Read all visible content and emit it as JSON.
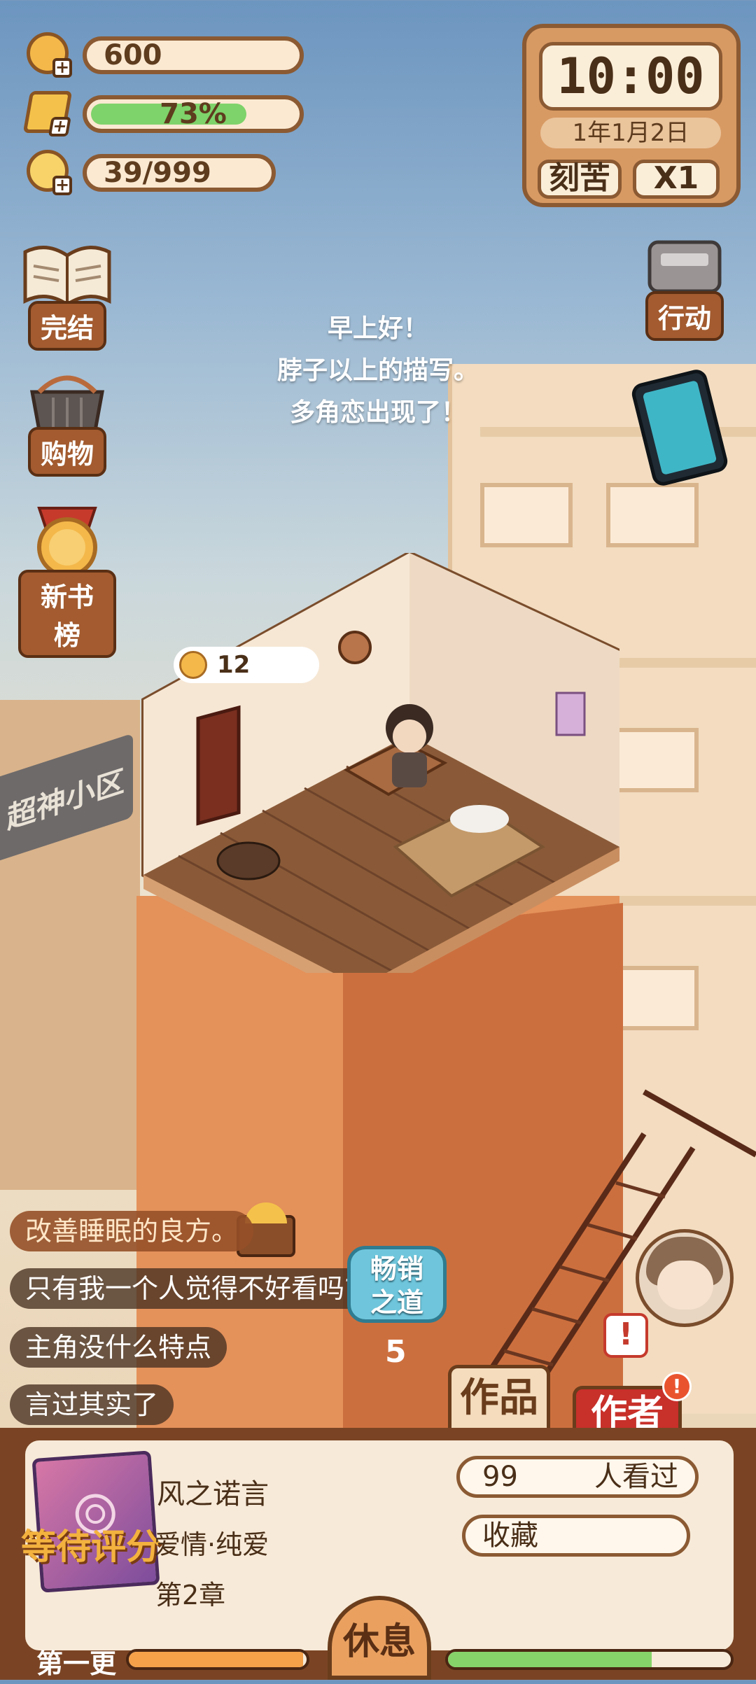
{
  "resources": {
    "coins": "600",
    "energy_label": "73%",
    "energy_pct": 0.73,
    "inspiration": "39/999"
  },
  "clock": {
    "time": "10:00",
    "date": "1年1月2日",
    "mode_button": "刻苦",
    "speed_button": "X1"
  },
  "menu": {
    "finish": "完结",
    "shopping": "购物",
    "new_books_rank": "新书榜",
    "action": "行动"
  },
  "greeting": [
    "早上好！",
    "脖子以上的描写。",
    "多角恋出现了！"
  ],
  "room": {
    "coin_reward": "12"
  },
  "street_sign": "超神小区",
  "comments": [
    "改善睡眠的良方。",
    "只有我一个人觉得不好看吗?",
    "主角没什么特点",
    "言过其实了"
  ],
  "bestseller": {
    "label_line1": "畅销",
    "label_line2": "之道",
    "count": "5"
  },
  "tabs": {
    "works": "作品",
    "author": "作者",
    "author_badge": "!"
  },
  "book": {
    "status": "等待评分",
    "title": "风之诺言",
    "genre": "爱情·纯爱",
    "chapter": "第2章",
    "views_count": "99",
    "views_label": "人看过",
    "favorite": "收藏"
  },
  "bottom": {
    "progress_label": "第一更",
    "rest_button": "休息",
    "left_progress_pct": 0.98,
    "right_progress_pct": 0.72
  },
  "colors": {
    "accent_orange": "#eaa160",
    "energy_green": "#7ed36a",
    "frame_brown": "#8b5a33"
  }
}
